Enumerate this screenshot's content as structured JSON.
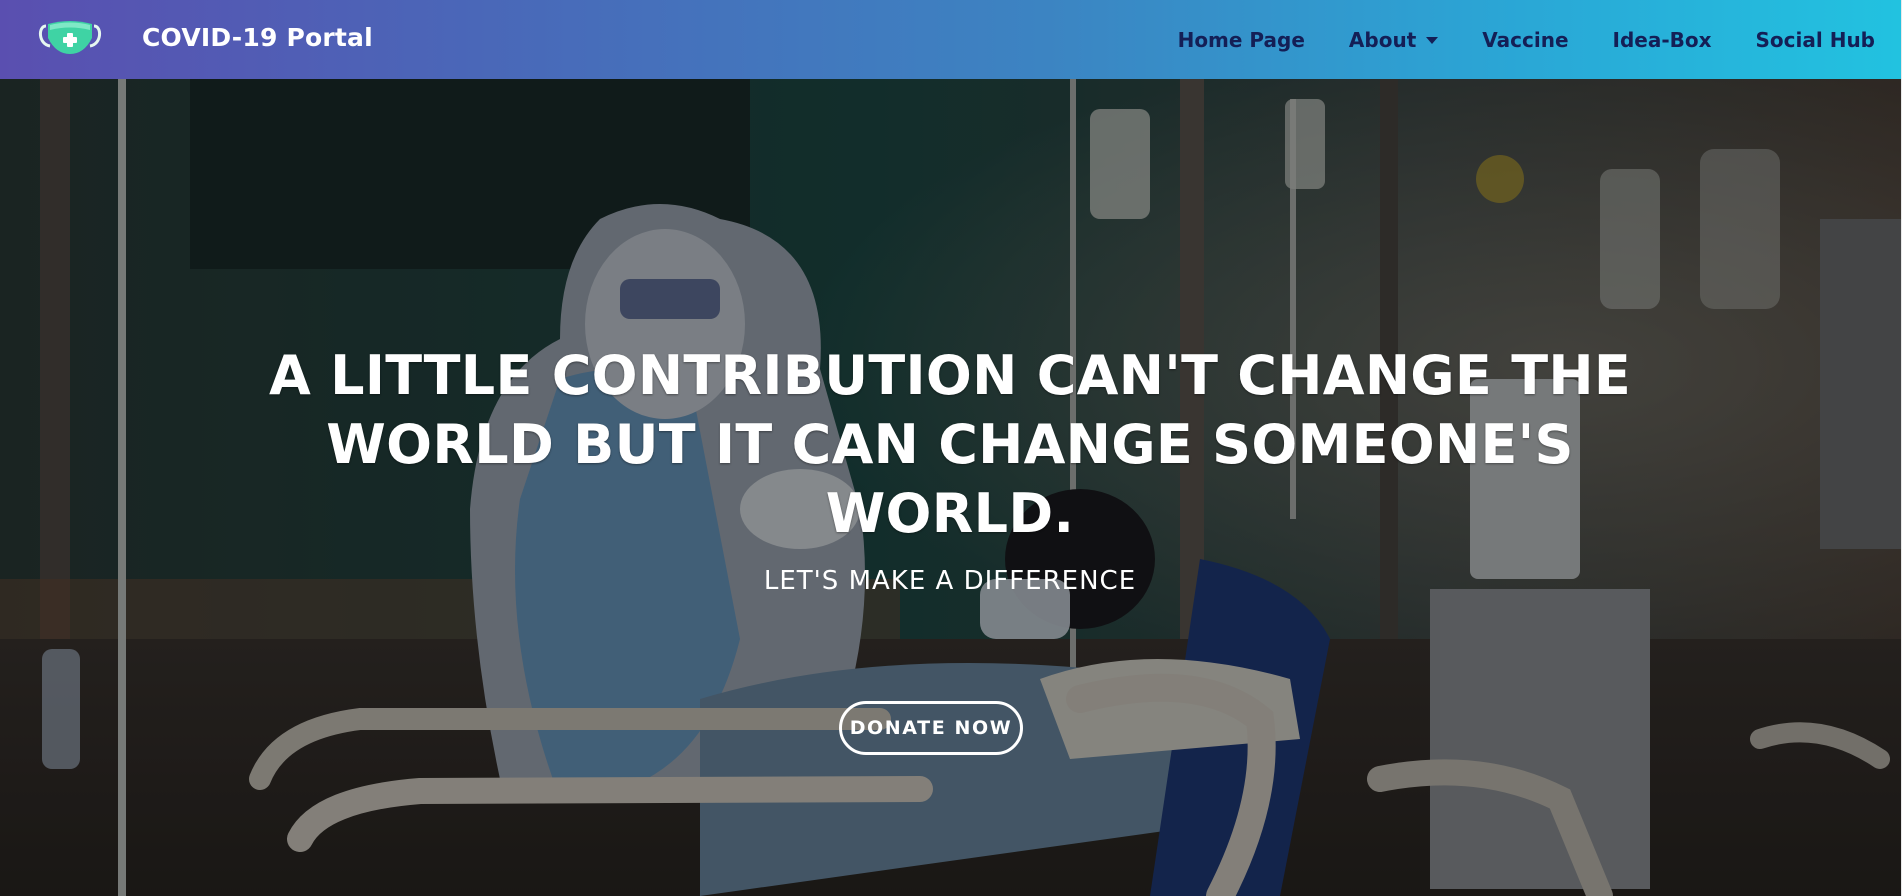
{
  "brand": {
    "name": "COVID-19 Portal",
    "icon": "mask-icon"
  },
  "nav": {
    "items": [
      {
        "label": "Home Page"
      },
      {
        "label": "About",
        "dropdown": true
      },
      {
        "label": "Vaccine"
      },
      {
        "label": "Idea-Box"
      },
      {
        "label": "Social Hub"
      }
    ]
  },
  "hero": {
    "title": "A LITTLE CONTRIBUTION CAN'T CHANGE THE WORLD BUT IT CAN CHANGE SOMEONE'S WORLD.",
    "subtitle": "LET'S MAKE A DIFFERENCE",
    "cta_label": "DONATE NOW"
  },
  "colors": {
    "nav_gradient_start": "#5a4fb0",
    "nav_gradient_end": "#22c2e0",
    "nav_text": "#141f56",
    "mask_green": "#3fd3a4"
  }
}
